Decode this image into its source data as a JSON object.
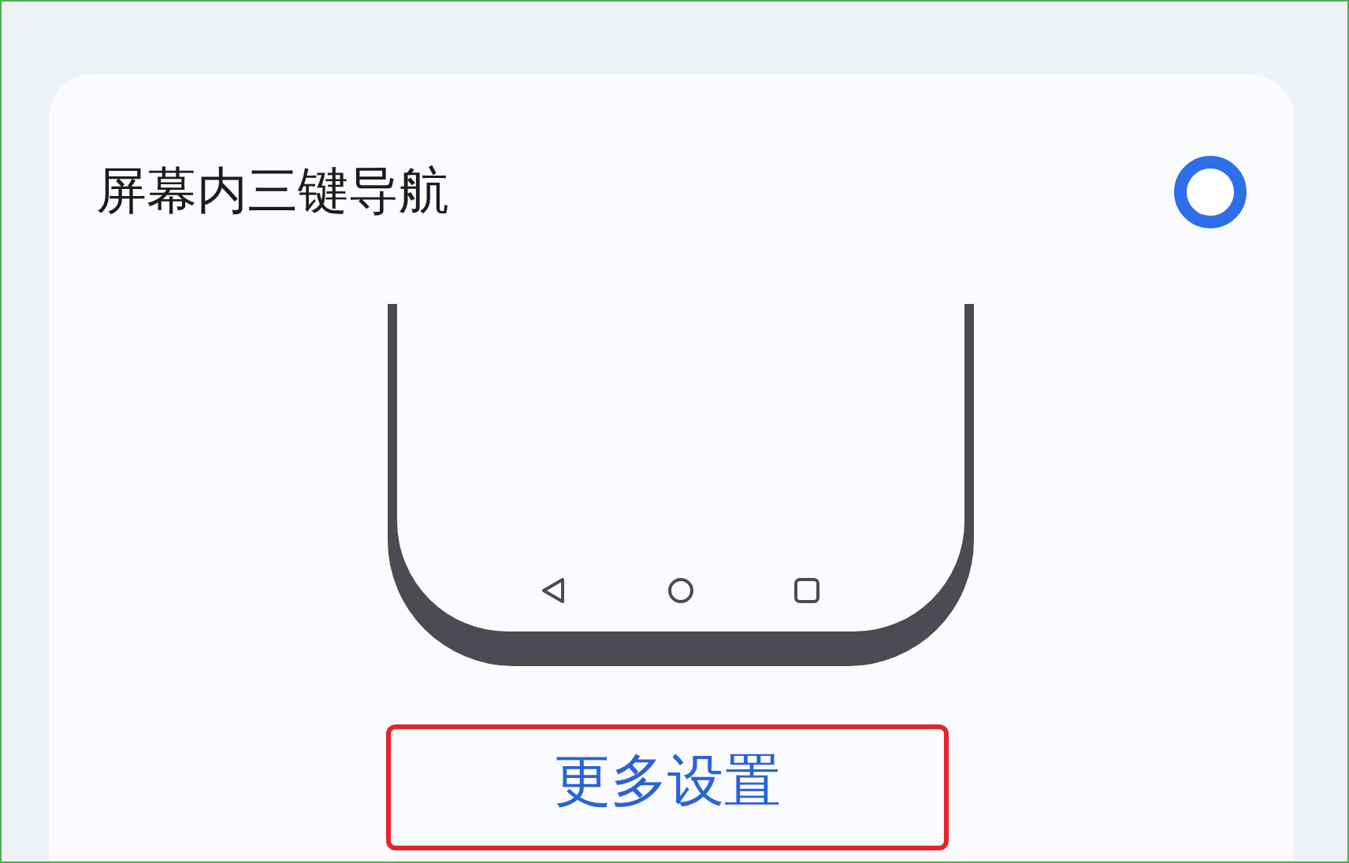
{
  "option": {
    "label": "屏幕内三键导航",
    "selected": true
  },
  "more_settings_button": {
    "label": "更多设置",
    "highlighted": true
  }
}
